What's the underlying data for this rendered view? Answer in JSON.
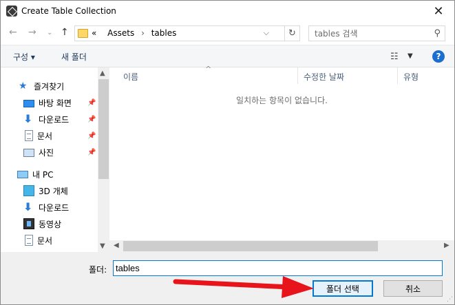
{
  "window": {
    "title": "Create Table Collection"
  },
  "nav": {
    "address": {
      "prefix": "«",
      "crumbs": [
        "Assets",
        "tables"
      ],
      "separator": "›"
    },
    "search_placeholder": "tables 검색"
  },
  "toolbar": {
    "organize": "구성 ▾",
    "new_folder": "새 폴더",
    "help": "?"
  },
  "sidebar": {
    "quick_access": "즐겨찾기",
    "quick_items": [
      {
        "label": "바탕 화면",
        "icon": "desktop-icon",
        "pinned": true
      },
      {
        "label": "다운로드",
        "icon": "download-icon",
        "pinned": true
      },
      {
        "label": "문서",
        "icon": "document-icon",
        "pinned": true
      },
      {
        "label": "사진",
        "icon": "pictures-icon",
        "pinned": true
      }
    ],
    "this_pc": "내 PC",
    "pc_items": [
      {
        "label": "3D 개체",
        "icon": "3d-objects-icon"
      },
      {
        "label": "다운로드",
        "icon": "download-icon"
      },
      {
        "label": "동영상",
        "icon": "video-icon"
      },
      {
        "label": "문서",
        "icon": "document-icon"
      }
    ]
  },
  "filelist": {
    "columns": [
      "이름",
      "수정한 날짜",
      "유형"
    ],
    "empty_message": "일치하는 항목이 없습니다."
  },
  "footer": {
    "folder_label": "폴더:",
    "folder_value": "tables",
    "select_button": "폴더 선택",
    "cancel_button": "취소"
  },
  "colors": {
    "accent": "#0078d7",
    "annotation": "#e8141b"
  }
}
